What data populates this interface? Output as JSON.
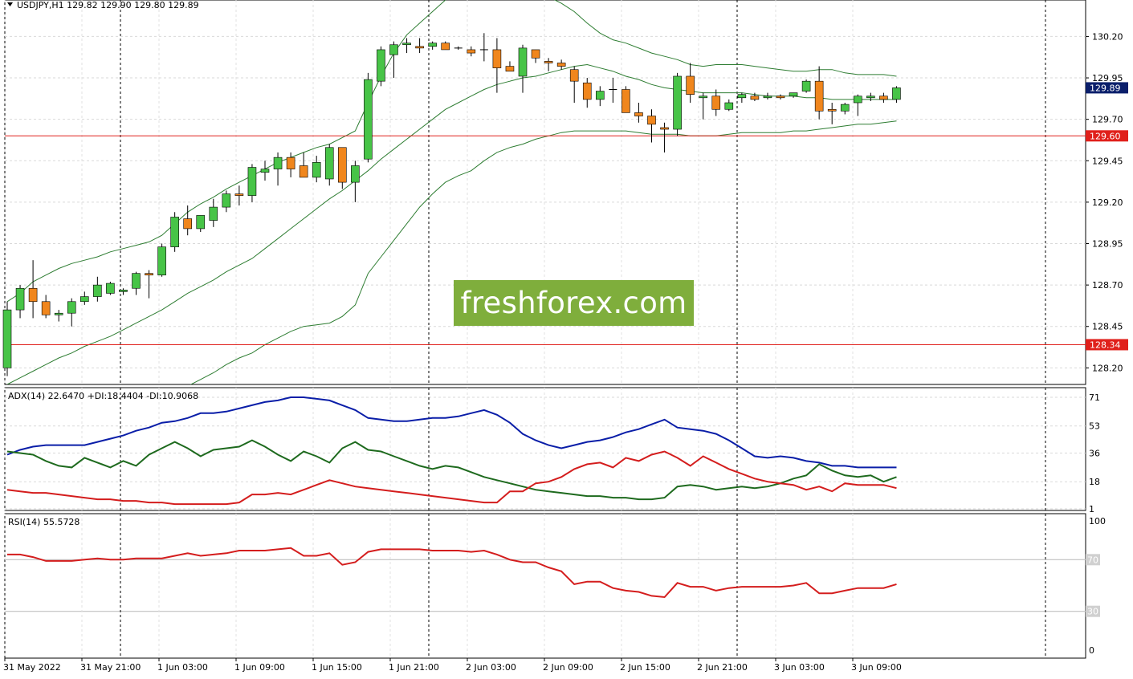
{
  "chart_data": {
    "type": "candlestick",
    "symbol_header": "USDJPY,H1  129.82 129.90 129.80 129.89",
    "price_ticks": [
      "130.20",
      "129.95",
      "129.70",
      "129.45",
      "129.20",
      "128.95",
      "128.70",
      "128.45",
      "128.20"
    ],
    "price_ticks_num": [
      130.2,
      129.95,
      129.7,
      129.45,
      129.2,
      128.95,
      128.7,
      128.45,
      128.2
    ],
    "price_range": [
      128.1,
      130.42
    ],
    "time_labels": [
      "31 May 2022",
      "31 May 21:00",
      "1 Jun 03:00",
      "1 Jun 09:00",
      "1 Jun 15:00",
      "1 Jun 21:00",
      "2 Jun 03:00",
      "2 Jun 09:00",
      "2 Jun 15:00",
      "2 Jun 21:00",
      "3 Jun 03:00",
      "3 Jun 09:00"
    ],
    "candles": [
      [
        128.2,
        128.6,
        128.15,
        128.55
      ],
      [
        128.55,
        128.7,
        128.5,
        128.68
      ],
      [
        128.68,
        128.85,
        128.5,
        128.6
      ],
      [
        128.6,
        128.64,
        128.5,
        128.52
      ],
      [
        128.52,
        128.55,
        128.48,
        128.53
      ],
      [
        128.53,
        128.62,
        128.45,
        128.6
      ],
      [
        128.6,
        128.66,
        128.58,
        128.63
      ],
      [
        128.63,
        128.75,
        128.6,
        128.7
      ],
      [
        128.65,
        128.72,
        128.64,
        128.71
      ],
      [
        128.66,
        128.68,
        128.64,
        128.67
      ],
      [
        128.68,
        128.78,
        128.64,
        128.77
      ],
      [
        128.77,
        128.79,
        128.62,
        128.76
      ],
      [
        128.76,
        128.95,
        128.75,
        128.93
      ],
      [
        128.93,
        129.14,
        128.9,
        129.11
      ],
      [
        129.1,
        129.18,
        129.0,
        129.04
      ],
      [
        129.04,
        129.12,
        129.02,
        129.12
      ],
      [
        129.09,
        129.22,
        129.05,
        129.17
      ],
      [
        129.17,
        129.27,
        129.14,
        129.25
      ],
      [
        129.25,
        129.3,
        129.18,
        129.24
      ],
      [
        129.24,
        129.43,
        129.2,
        129.41
      ],
      [
        129.38,
        129.45,
        129.33,
        129.4
      ],
      [
        129.4,
        129.5,
        129.3,
        129.47
      ],
      [
        129.47,
        129.5,
        129.35,
        129.4
      ],
      [
        129.42,
        129.5,
        129.36,
        129.35
      ],
      [
        129.35,
        129.48,
        129.32,
        129.44
      ],
      [
        129.34,
        129.55,
        129.3,
        129.53
      ],
      [
        129.53,
        129.53,
        129.28,
        129.32
      ],
      [
        129.32,
        129.45,
        129.2,
        129.42
      ],
      [
        129.46,
        129.98,
        129.44,
        129.94
      ],
      [
        129.93,
        130.14,
        129.9,
        130.12
      ],
      [
        130.09,
        130.17,
        129.95,
        130.15
      ],
      [
        130.15,
        130.19,
        130.1,
        130.16
      ],
      [
        130.14,
        130.19,
        130.1,
        130.13
      ],
      [
        130.14,
        130.17,
        130.12,
        130.16
      ],
      [
        130.16,
        130.17,
        130.12,
        130.12
      ],
      [
        130.13,
        130.14,
        130.12,
        130.13
      ],
      [
        130.12,
        130.14,
        130.08,
        130.1
      ],
      [
        130.12,
        130.22,
        130.05,
        130.12
      ],
      [
        130.12,
        130.19,
        129.86,
        130.01
      ],
      [
        130.02,
        130.05,
        129.99,
        129.99
      ],
      [
        129.96,
        130.15,
        129.86,
        130.13
      ],
      [
        130.12,
        130.12,
        130.04,
        130.07
      ],
      [
        130.05,
        130.07,
        129.99,
        130.04
      ],
      [
        130.04,
        130.06,
        130.0,
        130.02
      ],
      [
        130.0,
        130.02,
        129.8,
        129.93
      ],
      [
        129.92,
        129.95,
        129.77,
        129.82
      ],
      [
        129.82,
        129.9,
        129.78,
        129.87
      ],
      [
        129.88,
        129.95,
        129.8,
        129.88
      ],
      [
        129.88,
        129.9,
        129.78,
        129.74
      ],
      [
        129.74,
        129.8,
        129.68,
        129.72
      ],
      [
        129.72,
        129.76,
        129.56,
        129.67
      ],
      [
        129.65,
        129.68,
        129.5,
        129.64
      ],
      [
        129.64,
        129.98,
        129.6,
        129.96
      ],
      [
        129.96,
        130.04,
        129.8,
        129.85
      ],
      [
        129.83,
        129.86,
        129.7,
        129.84
      ],
      [
        129.84,
        129.88,
        129.72,
        129.76
      ],
      [
        129.76,
        129.82,
        129.75,
        129.8
      ],
      [
        129.83,
        129.86,
        129.8,
        129.85
      ],
      [
        129.84,
        129.86,
        129.81,
        129.82
      ],
      [
        129.83,
        129.86,
        129.82,
        129.84
      ],
      [
        129.84,
        129.85,
        129.82,
        129.83
      ],
      [
        129.84,
        129.86,
        129.83,
        129.86
      ],
      [
        129.87,
        129.94,
        129.86,
        129.93
      ],
      [
        129.93,
        130.02,
        129.7,
        129.75
      ],
      [
        129.76,
        129.8,
        129.67,
        129.75
      ],
      [
        129.75,
        129.8,
        129.73,
        129.79
      ],
      [
        129.8,
        129.85,
        129.72,
        129.84
      ],
      [
        129.83,
        129.86,
        129.81,
        129.84
      ],
      [
        129.84,
        129.86,
        129.8,
        129.82
      ],
      [
        129.82,
        129.9,
        129.8,
        129.89
      ]
    ],
    "bollinger_upper": [
      128.6,
      128.65,
      128.72,
      128.76,
      128.8,
      128.83,
      128.85,
      128.87,
      128.9,
      128.92,
      128.94,
      128.96,
      129.0,
      129.07,
      129.14,
      129.19,
      129.23,
      129.28,
      129.32,
      129.36,
      129.4,
      129.44,
      129.47,
      129.5,
      129.53,
      129.55,
      129.59,
      129.63,
      129.8,
      129.96,
      130.1,
      130.21,
      130.28,
      130.35,
      130.42,
      130.48,
      130.54,
      130.57,
      130.57,
      130.52,
      130.51,
      130.48,
      130.44,
      130.4,
      130.35,
      130.28,
      130.22,
      130.18,
      130.16,
      130.13,
      130.1,
      130.08,
      130.06,
      130.03,
      130.02,
      130.03,
      130.03,
      130.03,
      130.02,
      130.01,
      130.0,
      129.99,
      129.99,
      130.0,
      130.0,
      129.98,
      129.97,
      129.97,
      129.97,
      129.96
    ],
    "bollinger_middle": [
      128.1,
      128.14,
      128.18,
      128.22,
      128.26,
      128.29,
      128.33,
      128.36,
      128.39,
      128.43,
      128.47,
      128.51,
      128.55,
      128.6,
      128.65,
      128.69,
      128.73,
      128.78,
      128.82,
      128.86,
      128.92,
      128.98,
      129.04,
      129.1,
      129.16,
      129.22,
      129.27,
      129.33,
      129.39,
      129.46,
      129.52,
      129.58,
      129.64,
      129.7,
      129.76,
      129.8,
      129.84,
      129.88,
      129.91,
      129.93,
      129.95,
      129.96,
      129.98,
      130.0,
      130.02,
      130.03,
      130.01,
      129.99,
      129.96,
      129.94,
      129.91,
      129.89,
      129.88,
      129.87,
      129.86,
      129.86,
      129.86,
      129.86,
      129.85,
      129.84,
      129.84,
      129.84,
      129.83,
      129.83,
      129.82,
      129.82,
      129.82,
      129.82,
      129.82,
      129.82
    ],
    "bollinger_lower": [
      127.6,
      127.62,
      127.64,
      127.66,
      127.7,
      127.74,
      127.78,
      127.82,
      127.86,
      127.9,
      127.94,
      127.98,
      128.02,
      128.05,
      128.09,
      128.13,
      128.17,
      128.22,
      128.26,
      128.29,
      128.34,
      128.38,
      128.42,
      128.45,
      128.46,
      128.47,
      128.51,
      128.58,
      128.77,
      128.87,
      128.97,
      129.07,
      129.17,
      129.25,
      129.32,
      129.36,
      129.39,
      129.45,
      129.5,
      129.53,
      129.55,
      129.58,
      129.6,
      129.62,
      129.63,
      129.63,
      129.63,
      129.63,
      129.63,
      129.62,
      129.61,
      129.61,
      129.61,
      129.6,
      129.6,
      129.6,
      129.61,
      129.62,
      129.62,
      129.62,
      129.62,
      129.63,
      129.63,
      129.64,
      129.65,
      129.66,
      129.67,
      129.67,
      129.68,
      129.69
    ],
    "level_lines": [
      129.6,
      128.34
    ],
    "level_labels": [
      "129.60",
      "128.34"
    ],
    "current_price_label": "129.89",
    "current_price": 129.89,
    "adx": {
      "label": "ADX(14) 22.6470 +DI:18.4404 -DI:10.9068",
      "ticks": [
        "71",
        "53",
        "36",
        "18",
        "1"
      ],
      "ticks_num": [
        71,
        53,
        36,
        18,
        1
      ],
      "range": [
        0,
        74
      ],
      "adx": [
        35,
        38,
        40,
        41,
        41,
        41,
        41,
        43,
        45,
        47,
        50,
        52,
        55,
        56,
        58,
        61,
        61,
        62,
        64,
        66,
        68,
        69,
        71,
        71,
        70,
        69,
        66,
        63,
        58,
        57,
        56,
        56,
        57,
        58,
        58,
        59,
        61,
        63,
        60,
        55,
        48,
        44,
        41,
        39,
        41,
        43,
        44,
        46,
        49,
        51,
        54,
        57,
        52,
        51,
        50,
        48,
        44,
        39,
        34,
        33,
        34,
        33,
        31,
        30,
        28,
        28,
        27,
        27,
        27,
        27
      ],
      "plus_di": [
        37,
        36,
        35,
        31,
        28,
        27,
        33,
        30,
        27,
        31,
        28,
        35,
        39,
        43,
        39,
        34,
        38,
        39,
        40,
        44,
        40,
        35,
        31,
        37,
        34,
        30,
        39,
        43,
        38,
        37,
        34,
        31,
        28,
        26,
        28,
        27,
        24,
        21,
        19,
        17,
        15,
        13,
        12,
        11,
        10,
        9,
        9,
        8,
        8,
        7,
        7,
        8,
        15,
        16,
        15,
        13,
        14,
        15,
        14,
        15,
        17,
        20,
        22,
        29,
        25,
        22,
        21,
        22,
        18,
        21
      ],
      "minus_di": [
        13,
        12,
        11,
        11,
        10,
        9,
        8,
        7,
        7,
        6,
        6,
        5,
        5,
        4,
        4,
        4,
        4,
        4,
        5,
        10,
        10,
        11,
        10,
        13,
        16,
        19,
        17,
        15,
        14,
        13,
        12,
        11,
        10,
        9,
        8,
        7,
        6,
        5,
        5,
        12,
        12,
        17,
        18,
        21,
        26,
        29,
        30,
        27,
        33,
        31,
        35,
        37,
        33,
        28,
        34,
        30,
        26,
        23,
        20,
        18,
        17,
        16,
        13,
        15,
        12,
        17,
        16,
        16,
        16,
        14
      ]
    },
    "rsi": {
      "label": "RSI(14) 55.5728",
      "ticks": [
        "100",
        "70",
        "30",
        "0"
      ],
      "ticks_num": [
        100,
        70,
        30,
        0
      ],
      "range": [
        0,
        100
      ],
      "levels": [
        70,
        30
      ],
      "values": [
        74,
        74,
        72,
        69,
        69,
        69,
        70,
        71,
        70,
        70,
        71,
        71,
        71,
        73,
        75,
        73,
        74,
        75,
        77,
        77,
        77,
        78,
        79,
        73,
        73,
        75,
        66,
        68,
        76,
        78,
        78,
        78,
        78,
        77,
        77,
        77,
        76,
        77,
        74,
        70,
        68,
        68,
        64,
        61,
        51,
        53,
        53,
        48,
        46,
        45,
        42,
        41,
        52,
        49,
        49,
        46,
        48,
        49,
        49,
        49,
        49,
        50,
        52,
        44,
        44,
        46,
        48,
        48,
        48,
        51
      ]
    }
  }
}
